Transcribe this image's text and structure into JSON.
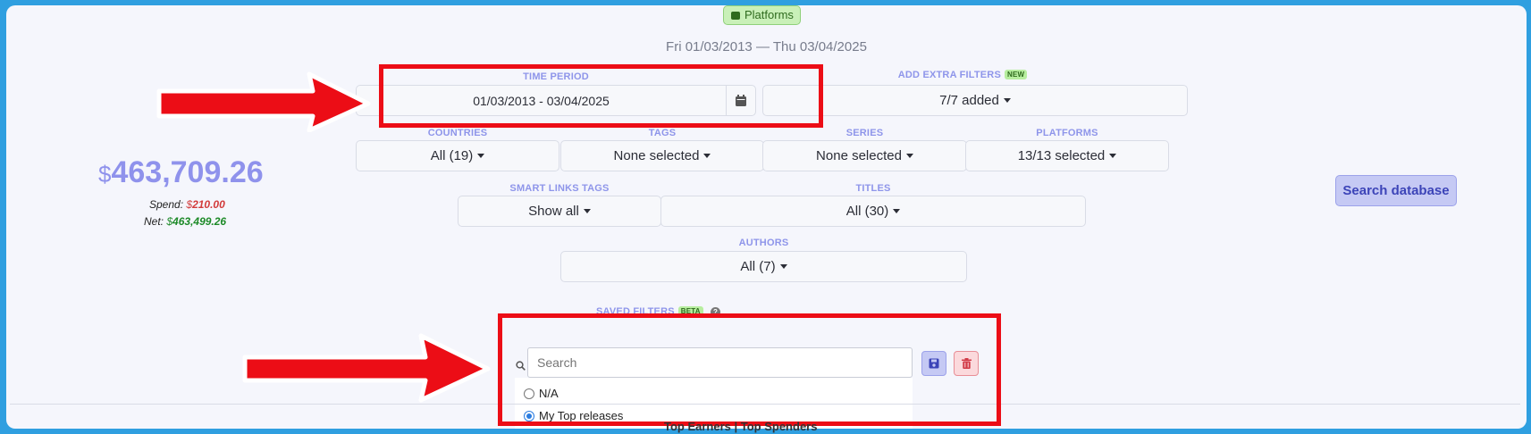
{
  "header": {
    "platforms_badge": "Platforms",
    "date_range_title": "Fri 01/03/2013 — Thu 03/04/2025"
  },
  "filters": {
    "time_period": {
      "label": "TIME PERIOD",
      "value": "01/03/2013 - 03/04/2025"
    },
    "extra_filters": {
      "label": "ADD EXTRA FILTERS",
      "tag": "NEW",
      "value": "7/7 added"
    },
    "countries": {
      "label": "COUNTRIES",
      "value": "All (19)"
    },
    "tags": {
      "label": "TAGS",
      "value": "None selected"
    },
    "series": {
      "label": "SERIES",
      "value": "None selected"
    },
    "platforms": {
      "label": "PLATFORMS",
      "value": "13/13 selected"
    },
    "smart_links_tags": {
      "label": "SMART LINKS TAGS",
      "value": "Show all"
    },
    "titles": {
      "label": "TITLES",
      "value": "All (30)"
    },
    "authors": {
      "label": "AUTHORS",
      "value": "All (7)"
    }
  },
  "summary": {
    "currency": "$",
    "total": "463,709.26",
    "spend_label": "Spend:",
    "spend_currency": "$",
    "spend_value": "210.00",
    "net_label": "Net:",
    "net_currency": "$",
    "net_value": "463,499.26"
  },
  "search_database_button": "Search database",
  "saved_filters": {
    "label": "SAVED FILTERS",
    "tag": "BETA",
    "search_placeholder": "Search",
    "options": [
      "N/A",
      "My Top releases"
    ],
    "selected": "My Top releases"
  },
  "bottom_cut_text": "Top Earners | Top Spenders",
  "colors": {
    "accent": "#8e95ea",
    "annotation_red": "#ec0d16",
    "spend_red": "#d23b3b",
    "net_green": "#1d8a28"
  }
}
